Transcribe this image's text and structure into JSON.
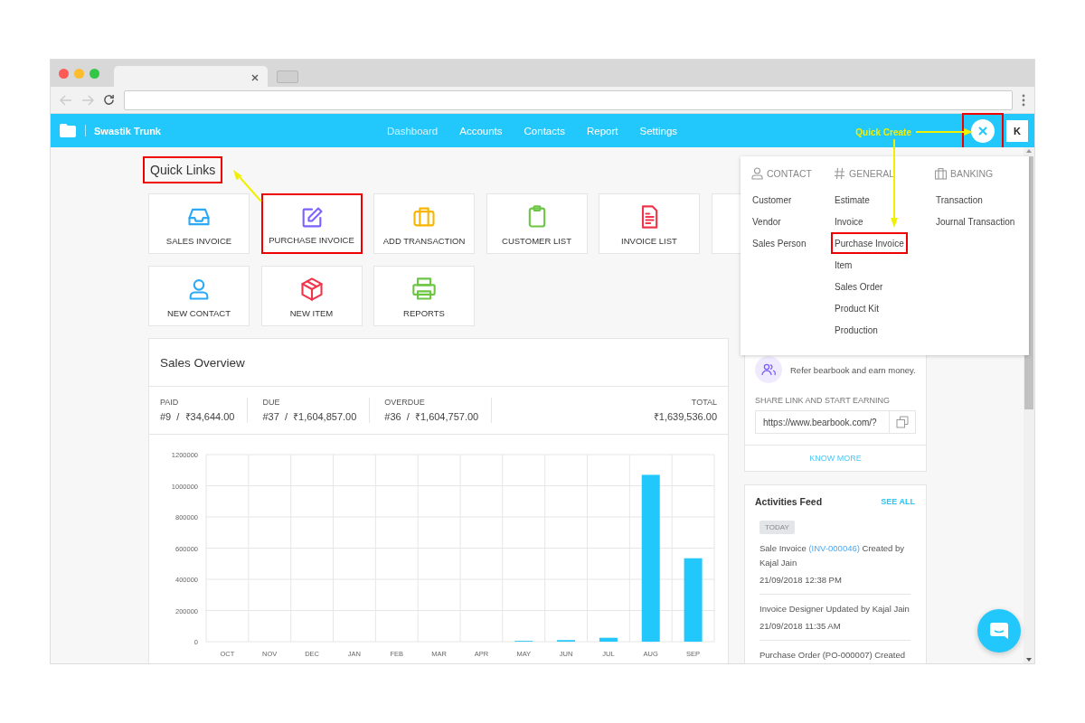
{
  "app": {
    "brand": "Swastik Trunk",
    "nav": [
      {
        "label": "Dashboard",
        "selected": true
      },
      {
        "label": "Accounts",
        "selected": false
      },
      {
        "label": "Contacts",
        "selected": false
      },
      {
        "label": "Report",
        "selected": false
      },
      {
        "label": "Settings",
        "selected": false
      }
    ],
    "quick_create_label": "Quick Create",
    "close_annotated": true,
    "avatar": "K"
  },
  "quick_links": {
    "title": "Quick Links",
    "annotated": true,
    "tiles": [
      {
        "label": "SALES INVOICE",
        "kind": "inbox",
        "color": "#2aa9f5",
        "annotated": false
      },
      {
        "label": "PURCHASE INVOICE",
        "kind": "edit",
        "color": "#7b61ff",
        "annotated": true
      },
      {
        "label": "ADD TRANSACTION",
        "kind": "briefcase",
        "color": "#f7b500",
        "annotated": false
      },
      {
        "label": "CUSTOMER LIST",
        "kind": "clipboard",
        "color": "#6cc644",
        "annotated": false
      },
      {
        "label": "INVOICE LIST",
        "kind": "document",
        "color": "#f0354b",
        "annotated": false
      },
      {
        "label": "NEW CONTACT",
        "kind": "user",
        "color": "#2aa9f5",
        "annotated": false
      },
      {
        "label": "NEW ITEM",
        "kind": "box",
        "color": "#f0354b",
        "annotated": false
      },
      {
        "label": "REPORTS",
        "kind": "printer",
        "color": "#6cc644",
        "annotated": false
      }
    ]
  },
  "sales_overview": {
    "title": "Sales Overview",
    "stats": [
      {
        "label": "PAID",
        "value": "#9  /  ₹34,644.00"
      },
      {
        "label": "DUE",
        "value": "#37  /  ₹1,604,857.00"
      },
      {
        "label": "OVERDUE",
        "value": "#36  /  ₹1,604,757.00"
      }
    ],
    "total": {
      "label": "TOTAL",
      "value": "₹1,639,536.00"
    },
    "chart_data": {
      "type": "bar",
      "categories": [
        "OCT",
        "NOV",
        "DEC",
        "JAN",
        "FEB",
        "MAR",
        "APR",
        "MAY",
        "JUN",
        "JUL",
        "AUG",
        "SEP"
      ],
      "grid": true,
      "series": [
        {
          "color": "#22c7fb",
          "values": [
            0,
            0,
            0,
            0,
            0,
            0,
            0,
            5000,
            10000,
            25000,
            1070000,
            535000
          ]
        }
      ],
      "ylim": [
        0,
        1200000
      ],
      "yticks": [
        0,
        200000,
        400000,
        600000,
        800000,
        1000000,
        1200000
      ]
    }
  },
  "refer": {
    "subtitle": "Refer bearbook and earn money.",
    "share_label": "SHARE LINK AND START EARNING",
    "link": "https://www.bearbook.com/?",
    "know_more": "KNOW MORE"
  },
  "activities": {
    "title": "Activities Feed",
    "see_all": "SEE ALL",
    "badge": "TODAY",
    "items": [
      {
        "kind": "link",
        "before": "Sale Invoice",
        "link": "(INV-000046)",
        "after": "Created by Kajal Jain",
        "time": "21/09/2018 12:38 PM"
      },
      {
        "kind": "plain",
        "text": "Invoice Designer Updated by Kajal Jain",
        "time": "21/09/2018 11:35 AM"
      },
      {
        "kind": "plain",
        "text": "Purchase Order (PO-000007) Created"
      }
    ]
  },
  "quick_create": {
    "open": true,
    "columns": [
      {
        "heading": "CONTACT",
        "kind": "user",
        "items": [
          {
            "label": "Customer",
            "annotated": false
          },
          {
            "label": "Vendor",
            "annotated": false
          },
          {
            "label": "Sales Person",
            "annotated": false
          }
        ]
      },
      {
        "heading": "GENERAL",
        "kind": "hash",
        "items": [
          {
            "label": "Estimate",
            "annotated": false
          },
          {
            "label": "Invoice",
            "annotated": false
          },
          {
            "label": "Purchase Invoice",
            "annotated": true
          },
          {
            "label": "Item",
            "annotated": false
          },
          {
            "label": "Sales Order",
            "annotated": false
          },
          {
            "label": "Product Kit",
            "annotated": false
          },
          {
            "label": "Production",
            "annotated": false
          }
        ]
      },
      {
        "heading": "BANKING",
        "kind": "bank",
        "items": [
          {
            "label": "Transaction",
            "annotated": false
          },
          {
            "label": "Journal Transaction",
            "annotated": false
          }
        ]
      }
    ]
  }
}
